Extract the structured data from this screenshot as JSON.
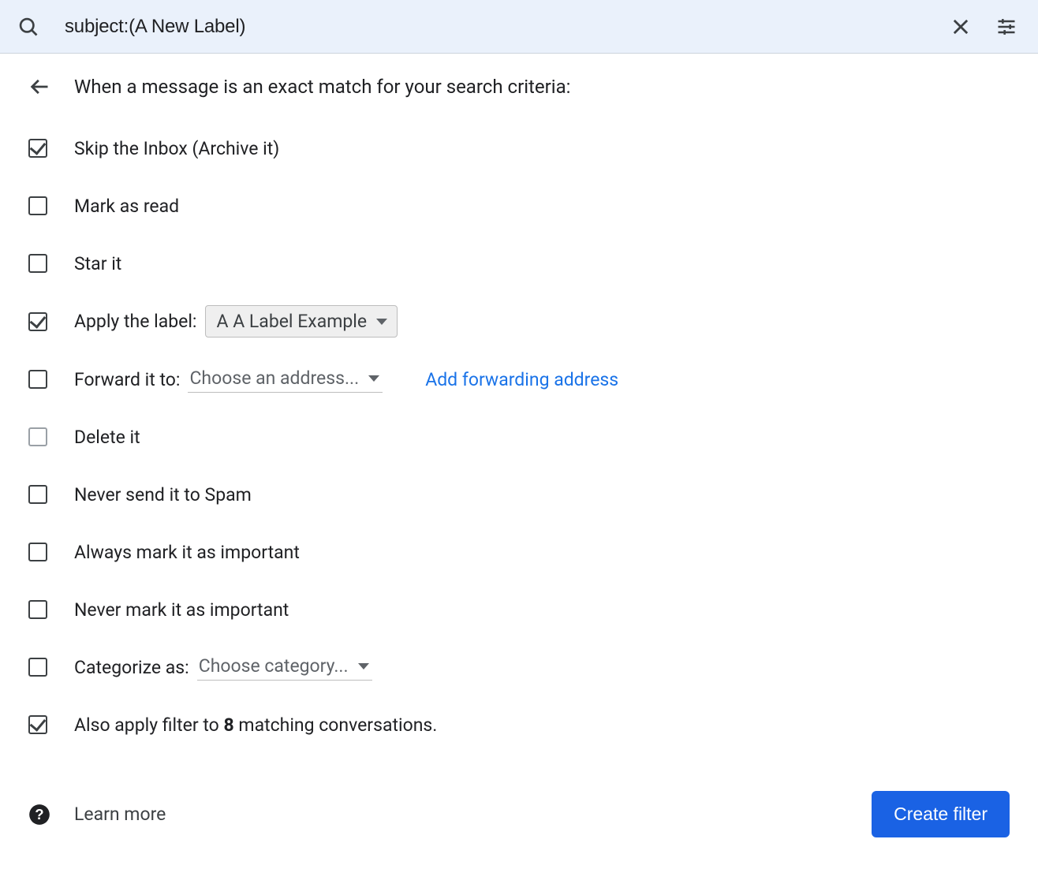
{
  "search": {
    "query": "subject:(A New Label)"
  },
  "header": {
    "title": "When a message is an exact match for your search criteria:"
  },
  "options": {
    "skip_inbox": {
      "label": "Skip the Inbox (Archive it)",
      "checked": true
    },
    "mark_read": {
      "label": "Mark as read",
      "checked": false
    },
    "star_it": {
      "label": "Star it",
      "checked": false
    },
    "apply_label": {
      "label": "Apply the label:",
      "checked": true,
      "selected": "A A Label Example"
    },
    "forward": {
      "label": "Forward it to:",
      "checked": false,
      "selected": "Choose an address...",
      "add_link": "Add forwarding address"
    },
    "delete_it": {
      "label": "Delete it",
      "checked": false
    },
    "never_spam": {
      "label": "Never send it to Spam",
      "checked": false
    },
    "always_important": {
      "label": "Always mark it as important",
      "checked": false
    },
    "never_important": {
      "label": "Never mark it as important",
      "checked": false
    },
    "categorize": {
      "label": "Categorize as:",
      "checked": false,
      "selected": "Choose category..."
    },
    "also_apply": {
      "prefix": "Also apply filter to ",
      "count": "8",
      "suffix": " matching conversations.",
      "checked": true
    }
  },
  "footer": {
    "learn_more": "Learn more",
    "create_filter": "Create filter"
  }
}
